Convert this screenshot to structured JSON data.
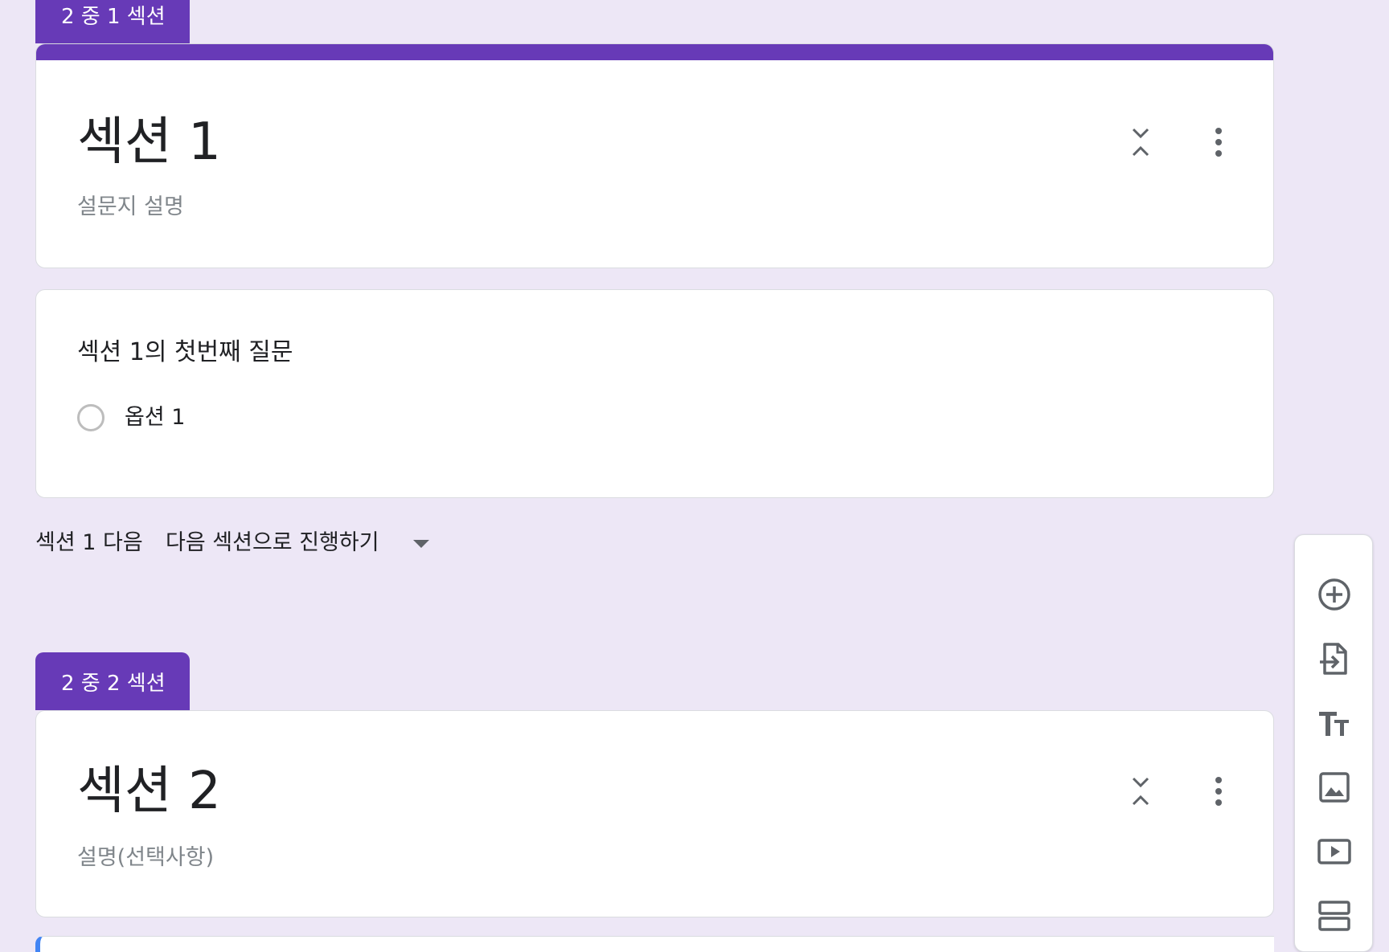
{
  "section1": {
    "tab_label": "2 중 1 섹션",
    "title": "섹션 1",
    "description_placeholder": "설문지 설명",
    "question": {
      "title": "섹션 1의 첫번째 질문",
      "options": [
        "옵션 1"
      ]
    },
    "after_label": "섹션 1 다음",
    "after_value": "다음 섹션으로 진행하기"
  },
  "section2": {
    "tab_label": "2 중 2 섹션",
    "title": "섹션 2",
    "description_placeholder": "설명(선택사항)"
  },
  "colors": {
    "accent": "#673ab7",
    "background": "#ede7f6"
  },
  "toolbar": {
    "icons": [
      "add-question-icon",
      "import-questions-icon",
      "add-title-icon",
      "add-image-icon",
      "add-video-icon",
      "add-section-icon"
    ]
  }
}
